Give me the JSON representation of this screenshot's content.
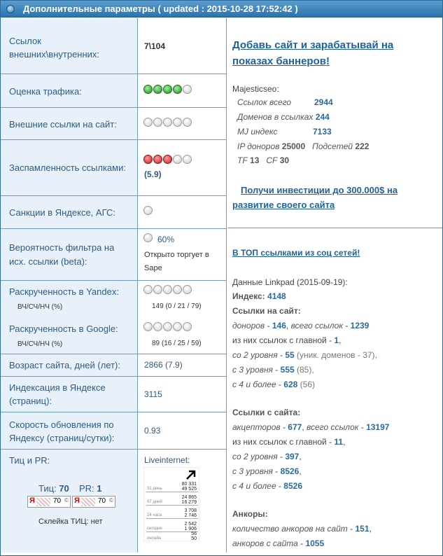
{
  "header": {
    "title": "Дополнительные параметры ( updated : 2015-10-28 17:52:42 )"
  },
  "rows": {
    "links": {
      "label": "Ссылок внешних\\внутренних:",
      "value": "7\\104"
    },
    "traffic": {
      "label": "Оценка трафика:",
      "dots": [
        "green",
        "green",
        "green",
        "green",
        "grey"
      ]
    },
    "ext_links": {
      "label": "Внешние ссылки на сайт:",
      "dots": [
        "grey",
        "grey",
        "grey",
        "grey",
        "grey"
      ]
    },
    "spam": {
      "label": "Заспамленность ссылками:",
      "dots": [
        "red",
        "red",
        "red",
        "grey",
        "grey"
      ],
      "value": "(5.9)"
    },
    "sanctions": {
      "label": "Санкции в Яндексе, АГС:",
      "dots": [
        "grey"
      ]
    },
    "filter": {
      "label": "Вероятность фильтра на исх. ссылки (beta):",
      "percent": "60%",
      "note": "Открыто торгует в Sape",
      "dots": [
        "grey"
      ]
    },
    "yandex": {
      "label": "Раскрученность в Yandex:",
      "sub": "ВЧ/СЧ/НЧ (%)",
      "value": "149 (0 / 21 / 79)",
      "dots": [
        "grey",
        "grey",
        "grey",
        "grey",
        "grey"
      ]
    },
    "google": {
      "label": "Раскрученность в Google:",
      "sub": "ВЧ/СЧ/НЧ (%)",
      "value": "89 (16 / 25 / 59)",
      "dots": [
        "grey",
        "grey",
        "grey",
        "grey",
        "grey"
      ]
    },
    "age": {
      "label": "Возраст сайта, дней (лет):",
      "value": "2866 (7.9)"
    },
    "index": {
      "label": "Индексация в Яндексе (страниц):",
      "value": "3115"
    },
    "speed": {
      "label": "Скорость обновления по Яндексу (страниц/сутки):",
      "value": "0.93"
    },
    "tic_pr": {
      "label": "Тиц и PR:",
      "tic_label": "Тиц:",
      "tic_value": "70",
      "pr_label": "PR:",
      "pr_value": "1",
      "badge_letter": "Я",
      "badge_value": "70",
      "glue": "Склейка ТИЦ: нет"
    },
    "liveinternet": {
      "label": "Liveinternet:",
      "rows": [
        {
          "name": "31 день",
          "a": "80 331",
          "b": "49 525"
        },
        {
          "name": "07 дней",
          "a": "24 865",
          "b": "16 279"
        },
        {
          "name": "24 часа",
          "a": "3 708",
          "b": "2 746"
        },
        {
          "name": "сегодня",
          "a": "2 542",
          "b": "1 906"
        },
        {
          "name": "онлайн",
          "a": "56",
          "b": "50"
        }
      ]
    }
  },
  "right_top": {
    "ad_link": "Добавь сайт и зарабатывай на показах баннеров!",
    "majestic_title": "Majesticseo:",
    "m_links_label": "Ссылок всего",
    "m_links": "2944",
    "m_domains_label": "Доменов в ссылках",
    "m_domains": "244",
    "m_mj_label": "MJ индекс",
    "m_mj": "7133",
    "m_ip_label": "IP доноров",
    "m_ip": "25000",
    "m_subnets_label": "Подсетей",
    "m_subnets": "222",
    "m_tf_label": "TF",
    "m_tf": "13",
    "m_cf_label": "CF",
    "m_cf": "30",
    "invest_link": "Получи инвестиции до 300.000$ на развитие своего сайта"
  },
  "right_bottom": {
    "top_link": "В ТОП ссылками из соц сетей!",
    "linkpad_title": "Данные Linkpad (2015-09-19):",
    "index_label": "Индекс:",
    "index_value": "4148",
    "in_title": "Ссылки на сайт:",
    "in_donors_label": "доноров",
    "in_donors": "146",
    "in_total_label": "всего ссылок",
    "in_total": "1239",
    "in_main_label": "из них ссылок с главной",
    "in_main": "1",
    "in_l2_label": "со 2 уровня",
    "in_l2": "55",
    "in_l2_extra": "(уник. доменов - 37),",
    "in_l3_label": "с 3 уровня",
    "in_l3": "555",
    "in_l3_extra": "(85),",
    "in_l4_label": "с 4 и более",
    "in_l4": "628",
    "in_l4_extra": "(56)",
    "out_title": "Ссылки с сайта:",
    "out_acc_label": "акцепторов",
    "out_acc": "677",
    "out_total_label": "всего ссылок",
    "out_total": "13197",
    "out_main_label": "из них ссылок с главной",
    "out_main": "11",
    "out_l2_label": "со 2 уровня",
    "out_l2": "397",
    "out_l3_label": "с 3 уровня",
    "out_l3": "8526",
    "out_l4_label": "с 4 и более",
    "out_l4": "8526",
    "anchors_title": "Анкоры:",
    "anch_in_label": "количество анкоров на сайт",
    "anch_in": "151",
    "anch_out_label": "анкоров с сайта",
    "anch_out": "1055"
  }
}
